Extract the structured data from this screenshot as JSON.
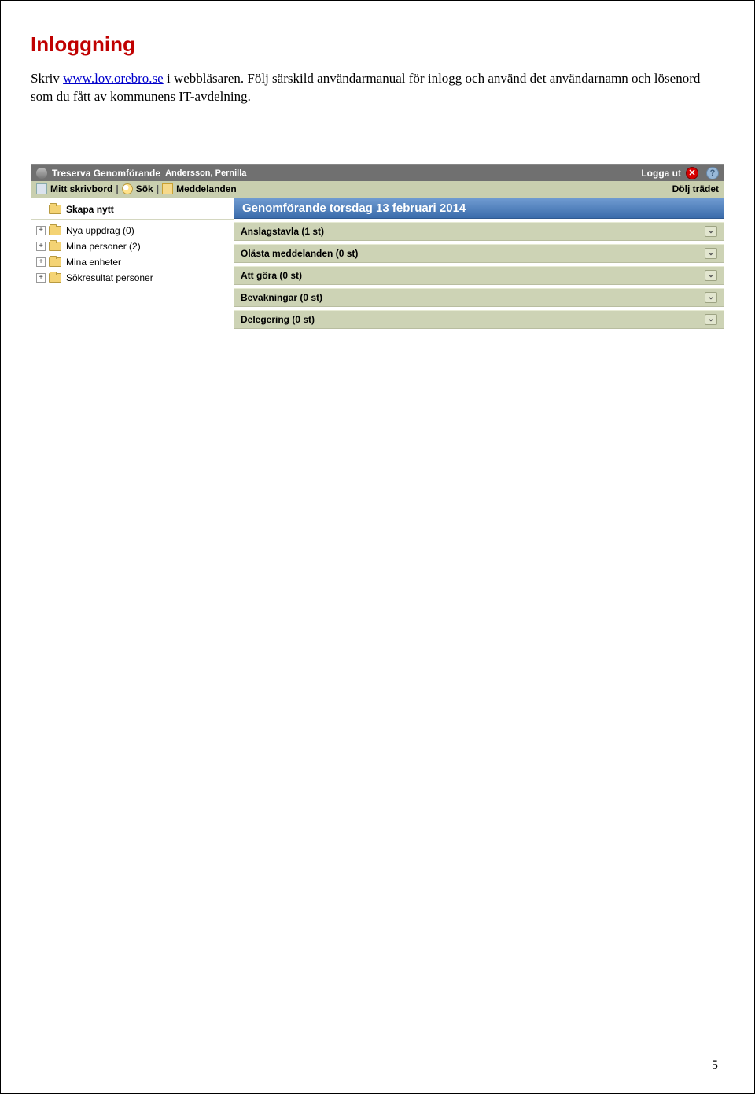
{
  "title": "Inloggning",
  "intro": {
    "pre": "Skriv ",
    "link": "www.lov.orebro.se",
    "post1": " i webbläsaren. Följ särskild användarmanual för inlogg och använd det användarnamn och lösenord som du fått av kommunens IT-avdelning."
  },
  "appbar": {
    "brand": "Treserva Genomförande",
    "user": "Andersson, Pernilla",
    "logout": "Logga ut"
  },
  "tabs": {
    "desktop": "Mitt skrivbord",
    "search": "Sök",
    "messages": "Meddelanden",
    "hide_tree": "Dölj trädet"
  },
  "tree": [
    {
      "label": "Skapa nytt",
      "expandable": false,
      "head": true
    },
    {
      "label": "Nya uppdrag (0)",
      "expandable": true
    },
    {
      "label": "Mina personer (2)",
      "expandable": true
    },
    {
      "label": "Mina enheter",
      "expandable": true
    },
    {
      "label": "Sökresultat personer",
      "expandable": true
    }
  ],
  "main_header": "Genomförande torsdag 13 februari 2014",
  "panels": [
    {
      "label": "Anslagstavla (1 st)"
    },
    {
      "label": "Olästa meddelanden (0 st)"
    },
    {
      "label": "Att göra (0 st)"
    },
    {
      "label": "Bevakningar (0 st)"
    },
    {
      "label": "Delegering (0 st)"
    }
  ],
  "page_number": "5"
}
